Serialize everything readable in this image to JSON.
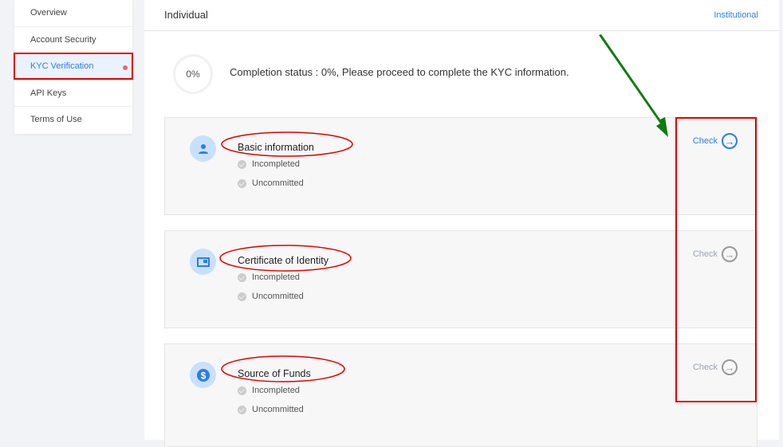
{
  "sidebar": {
    "items": [
      {
        "label": "Overview"
      },
      {
        "label": "Account Security"
      },
      {
        "label": "KYC Verification",
        "active": true
      },
      {
        "label": "API Keys"
      },
      {
        "label": "Terms of Use"
      }
    ]
  },
  "header": {
    "individual": "Individual",
    "institutional": "Institutional"
  },
  "completion": {
    "percent_label": "0%",
    "status": "Completion status : 0%, Please proceed to complete the KYC information."
  },
  "cards": [
    {
      "title": "Basic information",
      "icon": "user-icon",
      "status1": "Incompleted",
      "status2": "Uncommitted",
      "check": "Check",
      "enabled": true
    },
    {
      "title": "Certificate of Identity",
      "icon": "id-card-icon",
      "status1": "Incompleted",
      "status2": "Uncommitted",
      "check": "Check",
      "enabled": false
    },
    {
      "title": "Source of Funds",
      "icon": "dollar-icon",
      "status1": "Incompleted",
      "status2": "Uncommitted",
      "check": "Check",
      "enabled": false
    }
  ],
  "colors": {
    "accent": "#2d7ce8",
    "disabled": "#9aa4b2",
    "annotation_red": "#e00000",
    "annotation_green": "#0a7d0a"
  }
}
